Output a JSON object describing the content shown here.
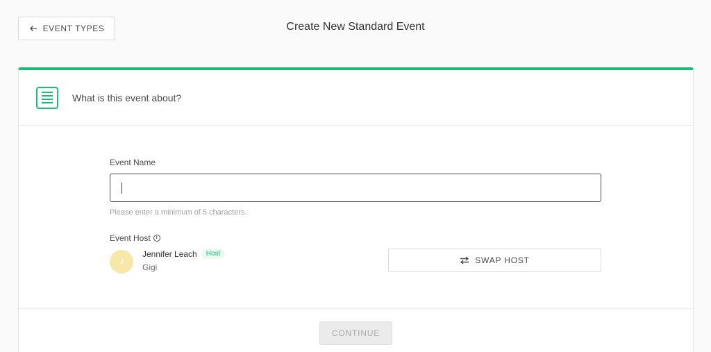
{
  "header": {
    "back_label": "EVENT TYPES",
    "title": "Create New Standard Event"
  },
  "card": {
    "header_text": "What is this event about?"
  },
  "form": {
    "event_name_label": "Event Name",
    "event_name_value": "",
    "event_name_hint": "Please enter a minimum of 5 characters.",
    "event_host_label": "Event Host",
    "host": {
      "initial": "J",
      "name": "Jennifer Leach",
      "badge": "Host",
      "subtitle": "Gigi"
    },
    "swap_host_label": "SWAP HOST"
  },
  "footer": {
    "continue_label": "CONTINUE"
  },
  "colors": {
    "accent": "#16c172",
    "avatar": "#f7e8a7"
  }
}
